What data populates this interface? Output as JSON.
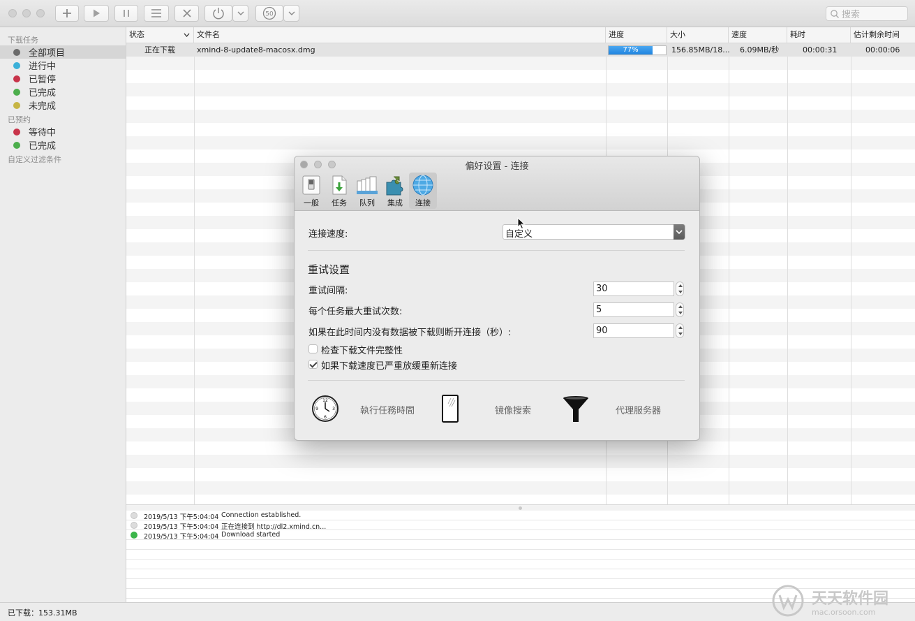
{
  "search": {
    "placeholder": "搜索"
  },
  "sidebar": {
    "groups": [
      "下载任务",
      "已预约",
      "自定义过滤条件"
    ],
    "items": [
      {
        "label": "全部项目",
        "color": "#6b6b6b"
      },
      {
        "label": "进行中",
        "color": "#3bb0d8"
      },
      {
        "label": "已暂停",
        "color": "#c8344a"
      },
      {
        "label": "已完成",
        "color": "#4cae4c"
      },
      {
        "label": "未完成",
        "color": "#c6b545"
      }
    ],
    "scheduled": [
      {
        "label": "等待中",
        "color": "#c8344a"
      },
      {
        "label": "已完成",
        "color": "#4cae4c"
      }
    ]
  },
  "table": {
    "columns": [
      "状态",
      "文件名",
      "进度",
      "大小",
      "速度",
      "耗时",
      "估计剩余时间"
    ],
    "rows": [
      {
        "status": "正在下载",
        "filename": "xmind-8-update8-macosx.dmg",
        "progress_text": "77%",
        "progress": 0.77,
        "size": "156.85MB/18...",
        "speed": "6.09MB/秒",
        "elapsed": "00:00:31",
        "remaining": "00:00:06"
      }
    ]
  },
  "log": [
    {
      "time": "2019/5/13 下午5:04:04",
      "message": "Connection established.",
      "color": "#dcdcdc"
    },
    {
      "time": "2019/5/13 下午5:04:04",
      "message": "正在连接到 http://dl2.xmind.cn...",
      "color": "#dcdcdc"
    },
    {
      "time": "2019/5/13 下午5:04:04",
      "message": "Download started",
      "color": "#3bb54a"
    }
  ],
  "status": {
    "downloaded": "已下载：153.31MB"
  },
  "dialog": {
    "title": "偏好设置 - 连接",
    "tabs": [
      "一般",
      "任务",
      "队列",
      "集成",
      "连接"
    ],
    "connection_speed_label": "连接速度:",
    "connection_speed_value": "自定义",
    "retry_section": "重试设置",
    "retry_interval_label": "重试间隔:",
    "retry_interval": "30",
    "max_retries_label": "每个任务最大重试次数:",
    "max_retries": "5",
    "timeout_label": "如果在此时间内没有数据被下载则断开连接（秒）:",
    "timeout": "90",
    "check_integrity_label": "检查下载文件完整性",
    "check_integrity": false,
    "reconnect_slow_label": "如果下载速度已严重放缓重新连接",
    "reconnect_slow": true,
    "tools": [
      "執行任務時間",
      "镜像搜索",
      "代理服务器"
    ]
  },
  "watermark": {
    "brand": "天天软件园",
    "domain": "mac.orsoon.com"
  }
}
